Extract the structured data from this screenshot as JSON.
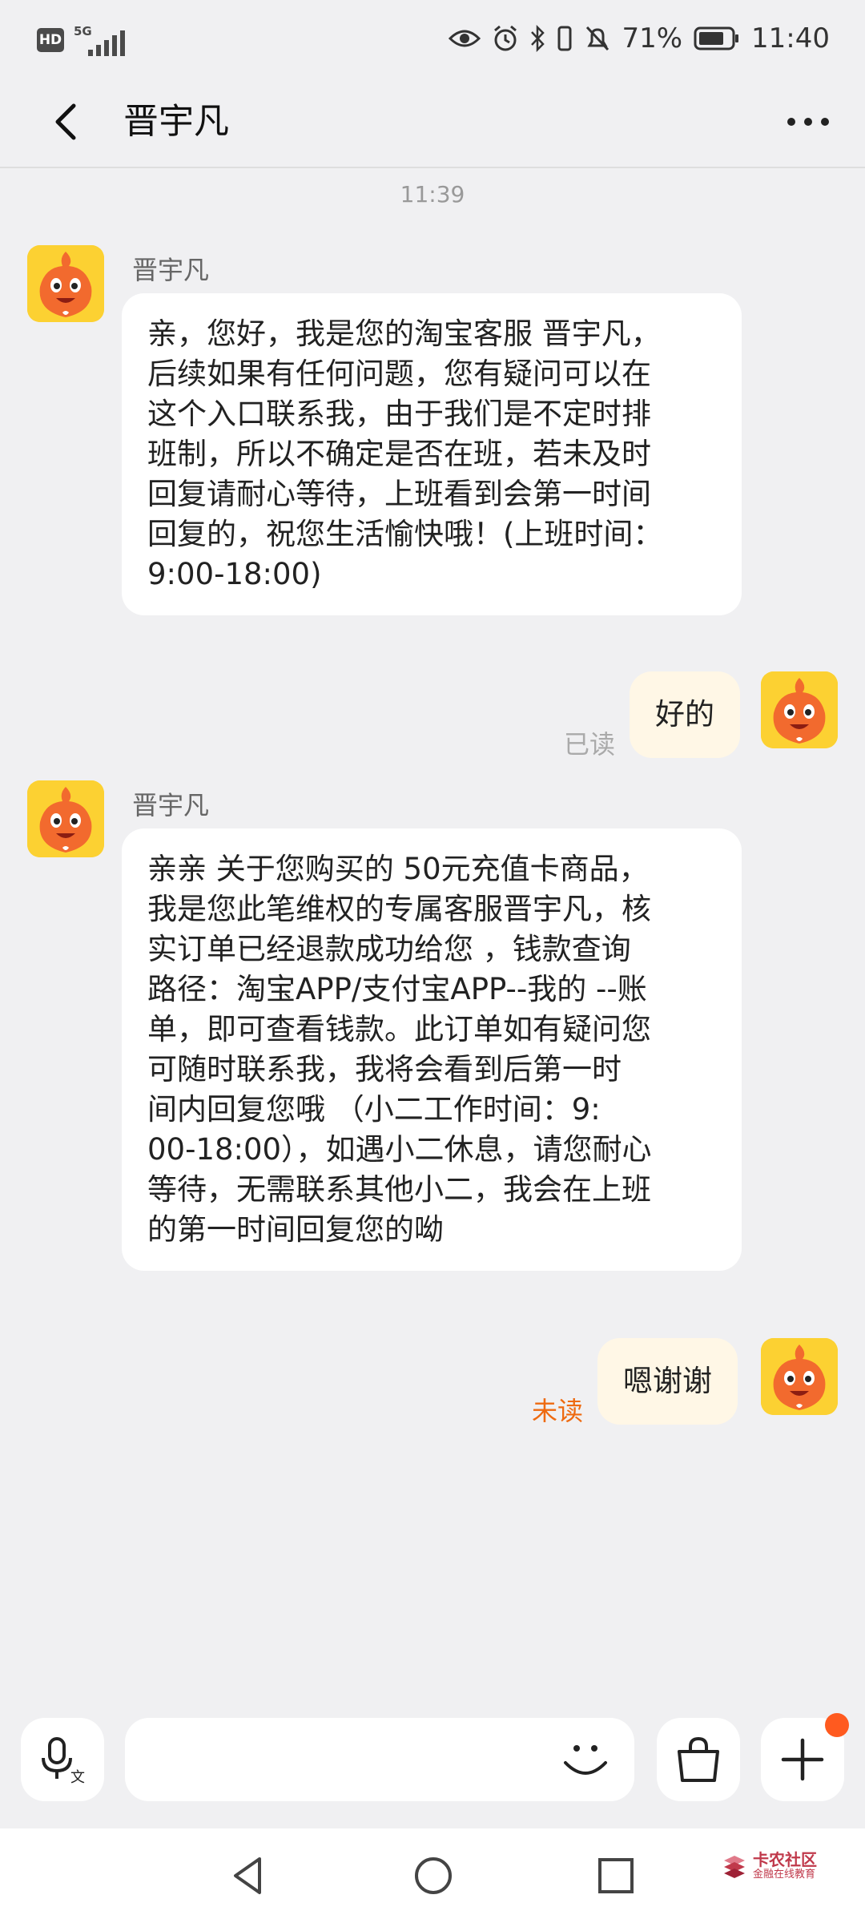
{
  "status_bar": {
    "hd": "HD",
    "network": "5G",
    "battery_percent": "71%",
    "time": "11:40",
    "icons": [
      "eye-icon",
      "alarm-icon",
      "bluetooth-icon",
      "vibrate-icon",
      "mute-bell-icon",
      "battery-icon"
    ]
  },
  "header": {
    "title": "晋宇凡",
    "back_icon": "chevron-left-icon",
    "more_icon": "more-dots-icon"
  },
  "chat": {
    "timestamp": "11:39",
    "messages": [
      {
        "direction": "incoming",
        "sender": "晋宇凡",
        "lines": [
          "亲，您好，我是您的淘宝客服 晋宇凡，",
          "后续如果有任何问题，您有疑问可以在",
          "这个入口联系我，由于我们是不定时排",
          "班制，所以不确定是否在班，若未及时",
          "回复请耐心等待，上班看到会第一时间",
          "回复的，祝您生活愉快哦！(上班时间：",
          "9:00-18:00)"
        ]
      },
      {
        "direction": "outgoing",
        "text": "好的",
        "status": "已读",
        "status_color": "#aaaaaa"
      },
      {
        "direction": "incoming",
        "sender": "晋宇凡",
        "lines": [
          "亲亲 关于您购买的  50元充值卡商品，",
          "我是您此笔维权的专属客服晋宇凡，核",
          "实订单已经退款成功给您 ，钱款查询",
          "路径：淘宝APP/支付宝APP--我的 --账",
          "单，即可查看钱款。此订单如有疑问您",
          "可随时联系我，我将会看到后第一时",
          "间内回复您哦  （小二工作时间：9:",
          "00-18:00），如遇小二休息，请您耐心",
          "等待，无需联系其他小二，我会在上班",
          "的第一时间回复您的呦"
        ]
      },
      {
        "direction": "outgoing",
        "text": "嗯谢谢",
        "status": "未读",
        "status_color": "#ee6a10"
      }
    ]
  },
  "input_bar": {
    "voice_icon": "microphone-icon",
    "placeholder": "",
    "emoji_icon": "smiley-icon",
    "shop_icon": "shopping-bag-icon",
    "plus_icon": "plus-icon",
    "accent": "#ff5a1f"
  },
  "nav_bar": {
    "back_icon": "triangle-back-icon",
    "home_icon": "circle-home-icon",
    "recents_icon": "square-recents-icon",
    "watermark_title": "卡农社区",
    "watermark_sub": "金融在线教育"
  },
  "colors": {
    "background": "#f0f0f2",
    "bubble_incoming": "#ffffff",
    "bubble_outgoing": "#fff7e6",
    "avatar_bg": "#fcd132"
  }
}
